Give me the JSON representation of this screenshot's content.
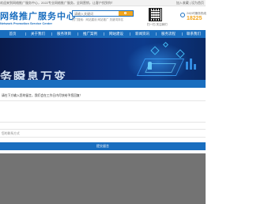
{
  "topbar": {
    "left_text": "欢迎来到网络推广服务中心，2022专业网络推广服务，全网营销，让客户找到你！",
    "right_text": "加入收藏 | 设为首页"
  },
  "header": {
    "logo_title": "网络推广服务中心",
    "logo_subtitle": "Network Promotion Service Center",
    "search_placeholder": "请输入关键词",
    "search_hot": "热门搜索：网站建设  网站推广  关键词排名",
    "qr_caption": "扫一扫 关注我们",
    "phone_label": "24小时服务热线",
    "phone_number": "18225"
  },
  "nav": {
    "items": [
      "首页",
      "关于我们",
      "服务项目",
      "推广案例",
      "网站建设",
      "新闻资讯",
      "服务流程",
      "联系我们"
    ]
  },
  "banner": {
    "text": "务瞬息万变"
  },
  "modal": {
    "title": "请在下方输入您的留言，我们会在工作日内尽快给予您回复！",
    "contact_placeholder": "您的联系方式",
    "submit_label": "提交留言"
  },
  "colors": {
    "brand_blue": "#1a6ebf",
    "accent_orange": "#f3a51c",
    "banner_dark": "#0a1a4a"
  }
}
